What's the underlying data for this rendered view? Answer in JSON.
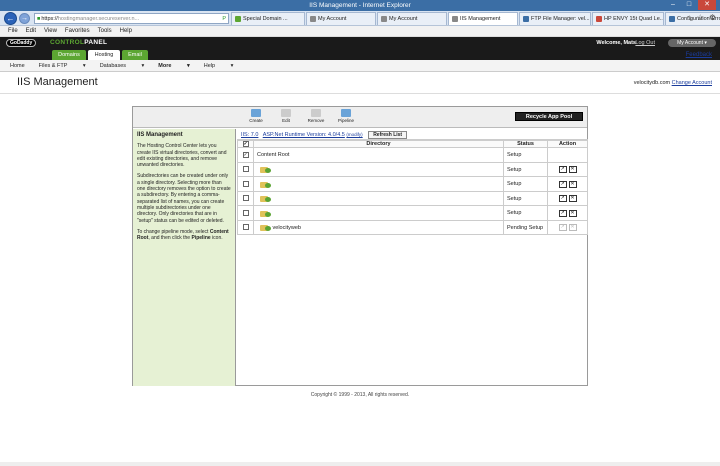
{
  "window": {
    "title": "IIS Management - Internet Explorer"
  },
  "browser": {
    "address": {
      "prefix": "https://",
      "host": "hostingmanager.secureserver.n...",
      "suffix": "P"
    },
    "tabs": [
      {
        "label": "Special Domain ...",
        "color": "#5ca632",
        "active": false
      },
      {
        "label": "My Account",
        "color": "#888888",
        "active": false
      },
      {
        "label": "My Account",
        "color": "#888888",
        "active": false
      },
      {
        "label": "IIS Management",
        "color": "#888888",
        "active": true
      },
      {
        "label": "FTP File Manager: vel...",
        "color": "#3b6ea5",
        "active": false
      },
      {
        "label": "HP ENVY 15t Quad Le...",
        "color": "#c9483b",
        "active": false
      },
      {
        "label": "Configuration Error",
        "color": "#3b6ea5",
        "active": false
      }
    ],
    "menu": [
      "File",
      "Edit",
      "View",
      "Favorites",
      "Tools",
      "Help"
    ]
  },
  "cp": {
    "logo": "GoDaddy",
    "title_a": "CONTROL",
    "title_b": "PANEL",
    "welcome": "Welcome, Mats",
    "logout": "Log Out",
    "my_account": "My Account",
    "tabs": [
      "Domains",
      "Hosting",
      "Email"
    ],
    "feedback": "Feedback",
    "subnav": [
      "Home",
      "Files & FTP",
      "Databases",
      "More",
      "Help"
    ]
  },
  "page": {
    "title": "IIS Management",
    "account_host": "velocitydb.com",
    "change_account": "Change Account"
  },
  "toolbar": {
    "buttons": [
      "Create",
      "Edit",
      "Remove",
      "Pipeline"
    ],
    "recycle": "Recycle App Pool"
  },
  "sidebar": {
    "heading": "IIS Management",
    "p1": "The Hosting Control Center lets you create IIS virtual directories, convert and edit existing directories, and remove unwanted directories.",
    "p2": "Subdirectories can be created under only a single directory. Selecting more than one directory removes the option to create a subdirectory. By entering a comma-separated list of names, you can create multiple subdirectories under one directory. Only directories that are in \"setup\" status can be edited or deleted.",
    "p3_a": "To change pipeline mode, select ",
    "p3_b": "Content Root",
    "p3_c": ", and then click the ",
    "p3_d": "Pipeline",
    "p3_e": " icon."
  },
  "runtime": {
    "iis": "IIS: 7.0",
    "aspnet": "ASP.Net Runtime Version: 4.0/4.5",
    "modify": "(modify)",
    "refresh": "Refresh List"
  },
  "table": {
    "headers": [
      "Directory",
      "Status",
      "Action"
    ],
    "rows": [
      {
        "name": "Content Root",
        "status": "Setup",
        "checked": true,
        "folder": false
      },
      {
        "name": "",
        "status": "Setup",
        "checked": false,
        "folder": true
      },
      {
        "name": "",
        "status": "Setup",
        "checked": false,
        "folder": true
      },
      {
        "name": "",
        "status": "Setup",
        "checked": false,
        "folder": true
      },
      {
        "name": "",
        "status": "Setup",
        "checked": false,
        "folder": true
      },
      {
        "name": "velocityweb",
        "status": "Pending Setup",
        "checked": false,
        "folder": true
      }
    ]
  },
  "footer": "Copyright © 1999 - 2013, All rights reserved."
}
